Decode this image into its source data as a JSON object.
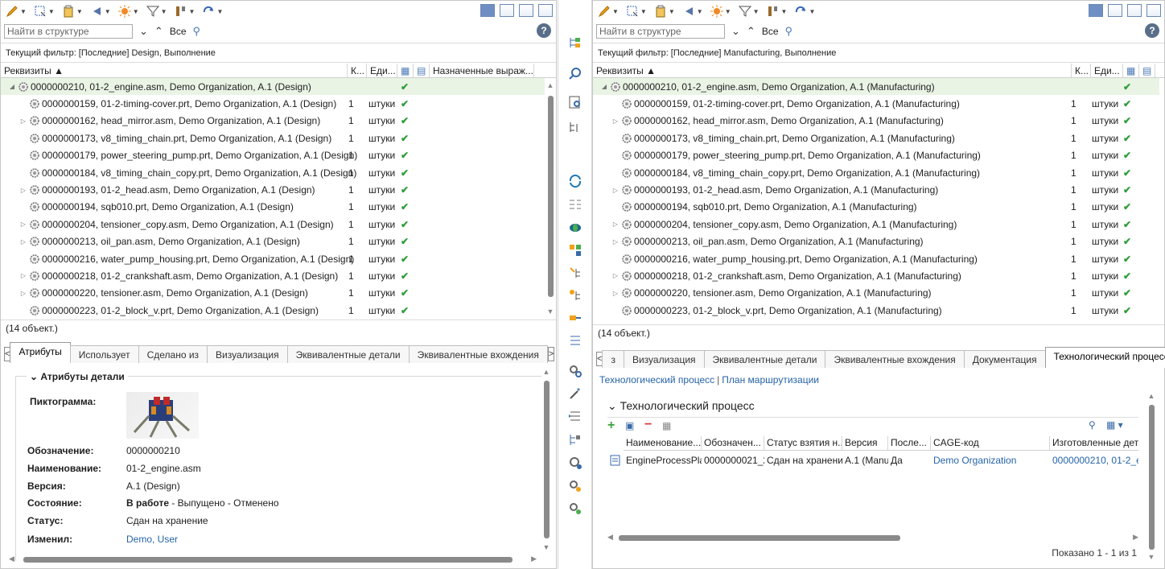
{
  "left": {
    "search_placeholder": "Найти в структуре",
    "search_scope": "Все",
    "filter_text": "Текущий фильтр: [Последние] Design, Выполнение",
    "columns": [
      "Реквизиты ▲",
      "К...",
      "Еди...",
      "Назначенные выраж..."
    ],
    "rows": [
      {
        "name": "0000000210, 01-2_engine.asm, Demo Organization, A.1 (Design)",
        "qty": "",
        "unit": "",
        "expander": "◢"
      },
      {
        "name": "0000000159, 01-2-timing-cover.prt, Demo Organization, A.1 (Design)",
        "qty": "1",
        "unit": "штуки",
        "expander": ""
      },
      {
        "name": "0000000162, head_mirror.asm, Demo Organization, A.1 (Design)",
        "qty": "1",
        "unit": "штуки",
        "expander": "▷"
      },
      {
        "name": "0000000173, v8_timing_chain.prt, Demo Organization, A.1 (Design)",
        "qty": "1",
        "unit": "штуки",
        "expander": ""
      },
      {
        "name": "0000000179, power_steering_pump.prt, Demo Organization, A.1 (Design)",
        "qty": "1",
        "unit": "штуки",
        "expander": ""
      },
      {
        "name": "0000000184, v8_timing_chain_copy.prt, Demo Organization, A.1 (Design)",
        "qty": "1",
        "unit": "штуки",
        "expander": ""
      },
      {
        "name": "0000000193, 01-2_head.asm, Demo Organization, A.1 (Design)",
        "qty": "1",
        "unit": "штуки",
        "expander": "▷"
      },
      {
        "name": "0000000194, sqb010.prt, Demo Organization, A.1 (Design)",
        "qty": "1",
        "unit": "штуки",
        "expander": ""
      },
      {
        "name": "0000000204, tensioner_copy.asm, Demo Organization, A.1 (Design)",
        "qty": "1",
        "unit": "штуки",
        "expander": "▷"
      },
      {
        "name": "0000000213, oil_pan.asm, Demo Organization, A.1 (Design)",
        "qty": "1",
        "unit": "штуки",
        "expander": "▷"
      },
      {
        "name": "0000000216, water_pump_housing.prt, Demo Organization, A.1 (Design)",
        "qty": "1",
        "unit": "штуки",
        "expander": ""
      },
      {
        "name": "0000000218, 01-2_crankshaft.asm, Demo Organization, A.1 (Design)",
        "qty": "1",
        "unit": "штуки",
        "expander": "▷"
      },
      {
        "name": "0000000220, tensioner.asm, Demo Organization, A.1 (Design)",
        "qty": "1",
        "unit": "штуки",
        "expander": "▷"
      },
      {
        "name": "0000000223, 01-2_block_v.prt, Demo Organization, A.1 (Design)",
        "qty": "1",
        "unit": "штуки",
        "expander": ""
      }
    ],
    "count_text": "(14 объект.)",
    "tabs": [
      "Атрибуты",
      "Использует",
      "Сделано из",
      "Визуализация",
      "Эквивалентные детали",
      "Эквивалентные вхождения"
    ],
    "section_title": "Атрибуты детали",
    "attrs": {
      "icon_label": "Пиктограмма:",
      "designation_label": "Обозначение:",
      "designation_value": "0000000210",
      "name_label": "Наименование:",
      "name_value": "01-2_engine.asm",
      "version_label": "Версия:",
      "version_value": "A.1 (Design)",
      "state_label": "Состояние:",
      "state_bold": "В работе",
      "state_rest": " - Выпущено - Отменено",
      "status_label": "Статус:",
      "status_value": "Сдан на хранение",
      "modified_label": "Изменил:",
      "modified_value": "Demo, User"
    }
  },
  "right": {
    "search_placeholder": "Найти в структуре",
    "search_scope": "Все",
    "filter_text": "Текущий фильтр: [Последние] Manufacturing, Выполнение",
    "columns": [
      "Реквизиты ▲",
      "К...",
      "Еди..."
    ],
    "rows": [
      {
        "name": "0000000210, 01-2_engine.asm, Demo Organization, A.1 (Manufacturing)",
        "qty": "",
        "unit": "",
        "expander": "◢"
      },
      {
        "name": "0000000159, 01-2-timing-cover.prt, Demo Organization, A.1 (Manufacturing)",
        "qty": "1",
        "unit": "штуки",
        "expander": ""
      },
      {
        "name": "0000000162, head_mirror.asm, Demo Organization, A.1 (Manufacturing)",
        "qty": "1",
        "unit": "штуки",
        "expander": "▷"
      },
      {
        "name": "0000000173, v8_timing_chain.prt, Demo Organization, A.1 (Manufacturing)",
        "qty": "1",
        "unit": "штуки",
        "expander": ""
      },
      {
        "name": "0000000179, power_steering_pump.prt, Demo Organization, A.1 (Manufacturing)",
        "qty": "1",
        "unit": "штуки",
        "expander": ""
      },
      {
        "name": "0000000184, v8_timing_chain_copy.prt, Demo Organization, A.1 (Manufacturing)",
        "qty": "1",
        "unit": "штуки",
        "expander": ""
      },
      {
        "name": "0000000193, 01-2_head.asm, Demo Organization, A.1 (Manufacturing)",
        "qty": "1",
        "unit": "штуки",
        "expander": "▷"
      },
      {
        "name": "0000000194, sqb010.prt, Demo Organization, A.1 (Manufacturing)",
        "qty": "1",
        "unit": "штуки",
        "expander": ""
      },
      {
        "name": "0000000204, tensioner_copy.asm, Demo Organization, A.1 (Manufacturing)",
        "qty": "1",
        "unit": "штуки",
        "expander": "▷"
      },
      {
        "name": "0000000213, oil_pan.asm, Demo Organization, A.1 (Manufacturing)",
        "qty": "1",
        "unit": "штуки",
        "expander": "▷"
      },
      {
        "name": "0000000216, water_pump_housing.prt, Demo Organization, A.1 (Manufacturing)",
        "qty": "1",
        "unit": "штуки",
        "expander": ""
      },
      {
        "name": "0000000218, 01-2_crankshaft.asm, Demo Organization, A.1 (Manufacturing)",
        "qty": "1",
        "unit": "штуки",
        "expander": "▷"
      },
      {
        "name": "0000000220, tensioner.asm, Demo Organization, A.1 (Manufacturing)",
        "qty": "1",
        "unit": "штуки",
        "expander": "▷"
      },
      {
        "name": "0000000223, 01-2_block_v.prt, Demo Organization, A.1 (Manufacturing)",
        "qty": "1",
        "unit": "штуки",
        "expander": ""
      }
    ],
    "count_text": "(14 объект.)",
    "tabs": [
      "з",
      "Визуализация",
      "Эквивалентные детали",
      "Эквивалентные вхождения",
      "Документация",
      "Технологический процесс"
    ],
    "sublinks": [
      "Технологический процесс",
      "План маршрутизации"
    ],
    "proc_title": "Технологический процесс",
    "proc_columns": [
      "Наименование...",
      "Обозначен...",
      "Статус взятия н...",
      "Версия",
      "После...",
      "CAGE-код",
      "Изготовленные дета"
    ],
    "proc_row": [
      "EngineProcessPlar",
      "0000000021_2",
      "Сдан на хранение",
      "A.1 (Manu",
      "Да",
      "Demo Organization",
      "0000000210, 01-2_e"
    ],
    "shown_text": "Показано 1 - 1 из 1"
  },
  "colors": {
    "check": "#2e9d3a",
    "link": "#2563a8",
    "selected_row": "#eaf4e5"
  }
}
